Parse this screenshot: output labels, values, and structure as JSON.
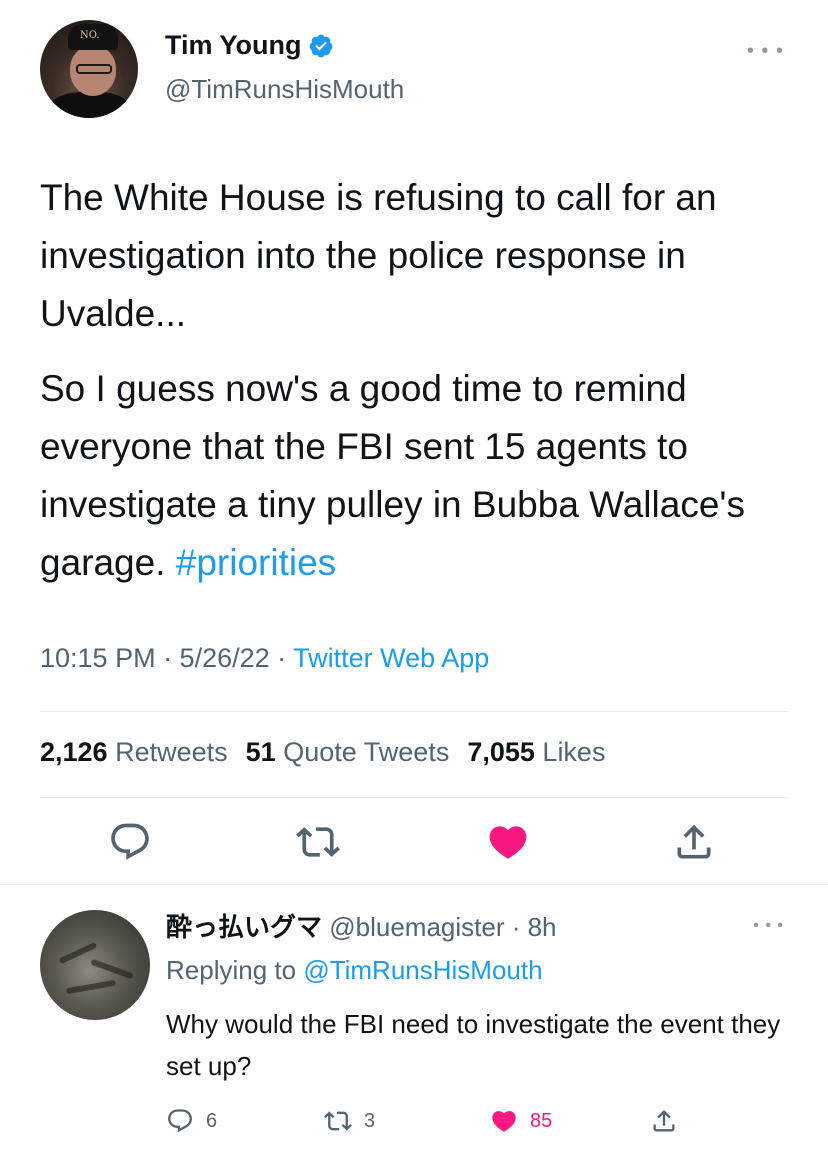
{
  "tweet": {
    "author_name": "Tim Young",
    "author_handle": "@TimRunsHisMouth",
    "avatar_cap_text": "NO.",
    "paragraph_1": "The White House is refusing to call for an investigation into the police response in Uvalde...",
    "paragraph_2": "So I guess now's a good time to remind everyone that the FBI sent 15 agents to investigate a tiny pulley in Bubba Wallace's garage.",
    "hashtag": "#priorities",
    "timestamp": "10:15 PM · 5/26/22 · ",
    "source": "Twitter Web App",
    "stats": {
      "retweets_count": "2,126",
      "retweets_label": "Retweets",
      "quotes_count": "51",
      "quotes_label": "Quote Tweets",
      "likes_count": "7,055",
      "likes_label": "Likes"
    },
    "colors": {
      "accent": "#1d9bf0",
      "like": "#f91880",
      "muted": "#536471"
    }
  },
  "reply": {
    "display_name": "酔っ払いグマ",
    "handle_time": "@bluemagister · 8h",
    "replying_prefix": "Replying to ",
    "replying_handle": "@TimRunsHisMouth",
    "text": "Why would the FBI need to investigate the event they set up?",
    "replies": "6",
    "retweets": "3",
    "likes": "85"
  },
  "icons": {
    "verified": "verified-badge-icon",
    "more": "more-icon",
    "reply": "reply-icon",
    "retweet": "retweet-icon",
    "like": "heart-icon",
    "share": "share-icon"
  }
}
